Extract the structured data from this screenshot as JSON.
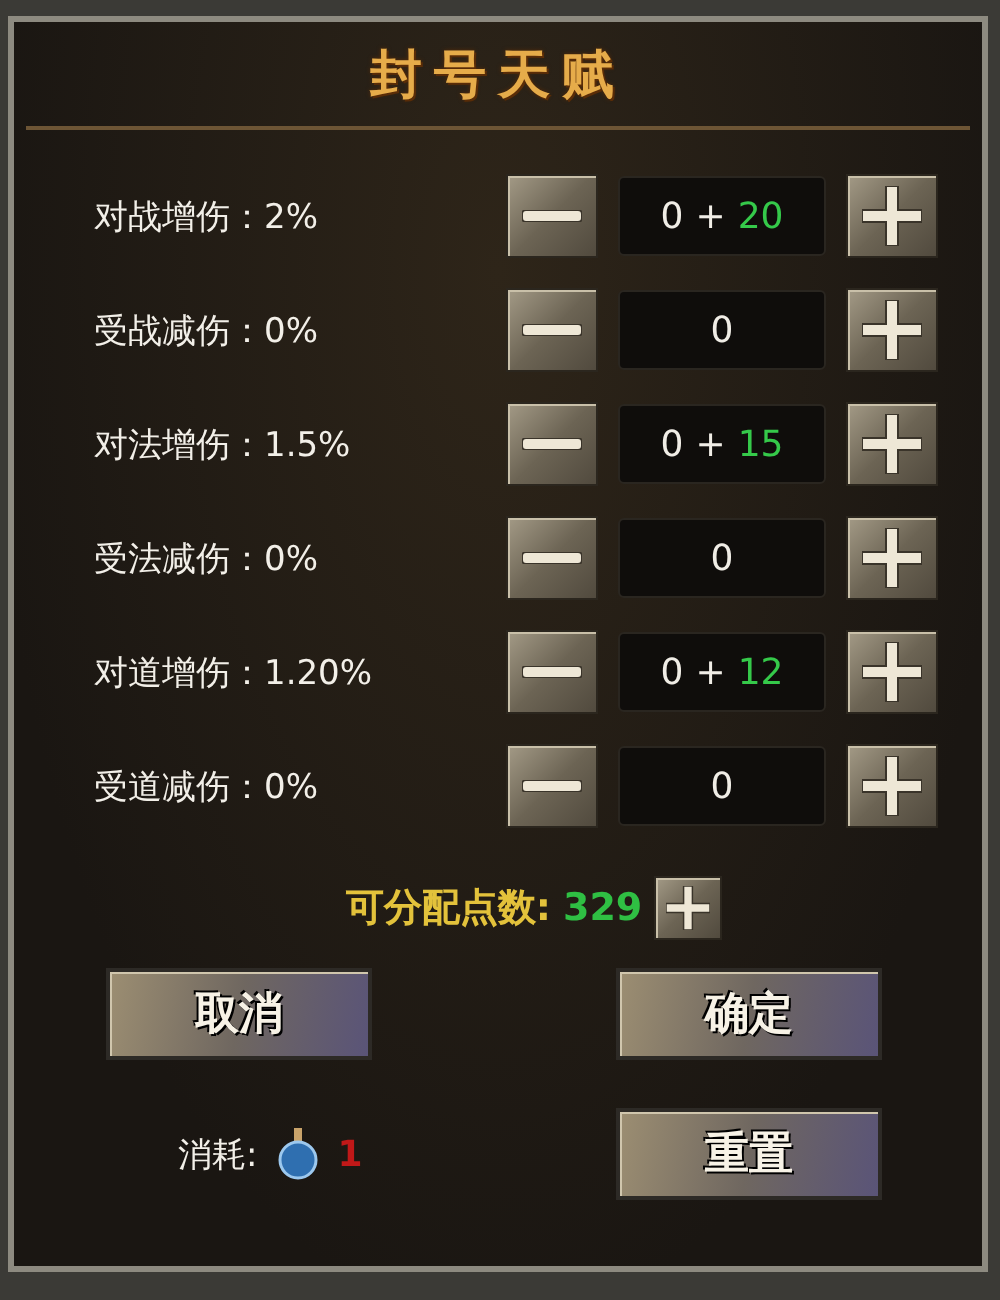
{
  "title": "封号天赋",
  "talents": [
    {
      "label": "对战增伤：2%",
      "base": "0",
      "sign": "+",
      "bonus": "20"
    },
    {
      "label": "受战减伤：0%",
      "base": "0"
    },
    {
      "label": "对法增伤：1.5%",
      "base": "0",
      "sign": "+",
      "bonus": "15"
    },
    {
      "label": "受法减伤：0%",
      "base": "0"
    },
    {
      "label": "对道增伤：1.20%",
      "base": "0",
      "sign": "+",
      "bonus": "12"
    },
    {
      "label": "受道减伤：0%",
      "base": "0"
    }
  ],
  "points": {
    "label": "可分配点数:",
    "value": "329"
  },
  "buttons": {
    "cancel": "取消",
    "confirm": "确定",
    "reset": "重置"
  },
  "cost": {
    "label": "消耗:",
    "value": "1"
  }
}
